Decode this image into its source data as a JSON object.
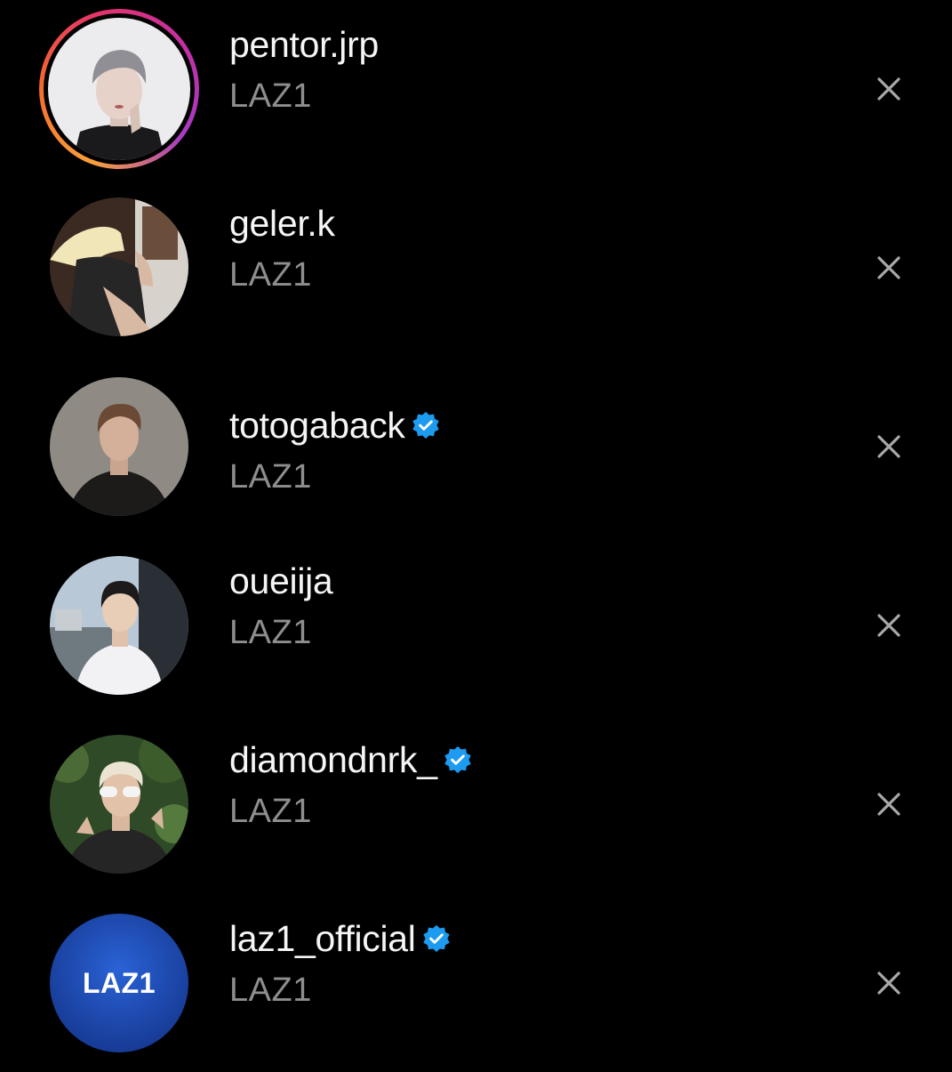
{
  "accounts": [
    {
      "username": "pentor.jrp",
      "subtitle": "LAZ1",
      "verified": false,
      "has_story": true,
      "avatar": "photo-person-grey-hair"
    },
    {
      "username": "geler.k",
      "subtitle": "LAZ1",
      "verified": false,
      "has_story": false,
      "avatar": "photo-person-blond"
    },
    {
      "username": "totogaback",
      "subtitle": "LAZ1",
      "verified": true,
      "has_story": false,
      "avatar": "photo-person-brown-hair"
    },
    {
      "username": "oueiija",
      "subtitle": "LAZ1",
      "verified": false,
      "has_story": false,
      "avatar": "photo-person-outdoor"
    },
    {
      "username": "diamondnrk_",
      "subtitle": "LAZ1",
      "verified": true,
      "has_story": false,
      "avatar": "photo-person-sunglasses"
    },
    {
      "username": "laz1_official",
      "subtitle": "LAZ1",
      "verified": true,
      "has_story": false,
      "avatar": "brand-logo",
      "logo_text": "LAZ1"
    }
  ],
  "icons": {
    "remove": "close-icon",
    "verified": "verified-badge-icon"
  },
  "colors": {
    "background": "#000000",
    "username": "#f5f5f5",
    "subtitle": "#8e8e8e",
    "verified_badge": "#1d9bf0",
    "close_icon": "#a8a8a8",
    "logo_bg": "#1f4fb8"
  }
}
